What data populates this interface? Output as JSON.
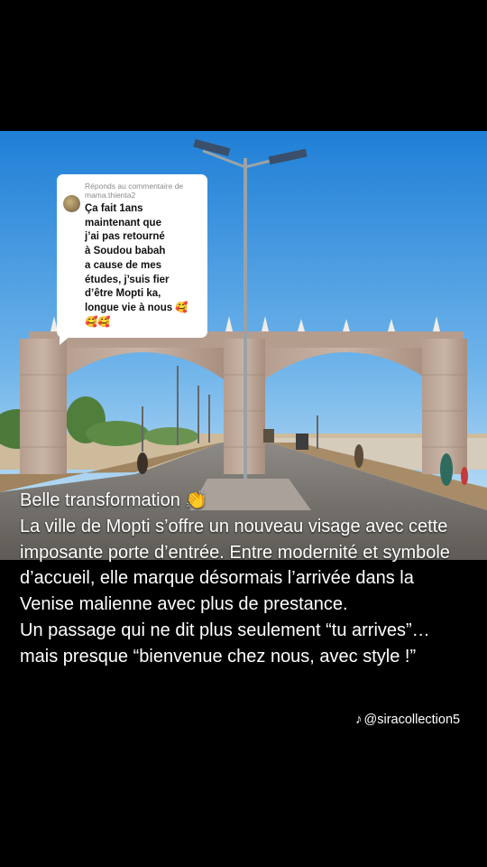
{
  "reply_bubble": {
    "header": "Réponds au commentaire de\nmama.thienta2",
    "message": "Ça fait 1ans\nmaintenant que\nj’ai pas retourné\nà Soudou babah\na cause de mes\nétudes, j’suis fier\nd’être Mopti ka,\nlongue vie à nous 🥰\n🥰🥰"
  },
  "caption": {
    "lines": [
      "Belle transformation 👏",
      "La ville de Mopti s’offre un nouveau visage avec cette imposante porte d’entrée. Entre modernité et symbole d’accueil, elle marque désormais l’arrivée dans la Venise malienne avec plus de prestance.",
      "Un passage qui ne dit plus seulement “tu arrives”… mais presque “bienvenue chez nous, avec style !”"
    ]
  },
  "watermark": {
    "icon": "tiktok-icon",
    "handle": "@siracollection5"
  }
}
